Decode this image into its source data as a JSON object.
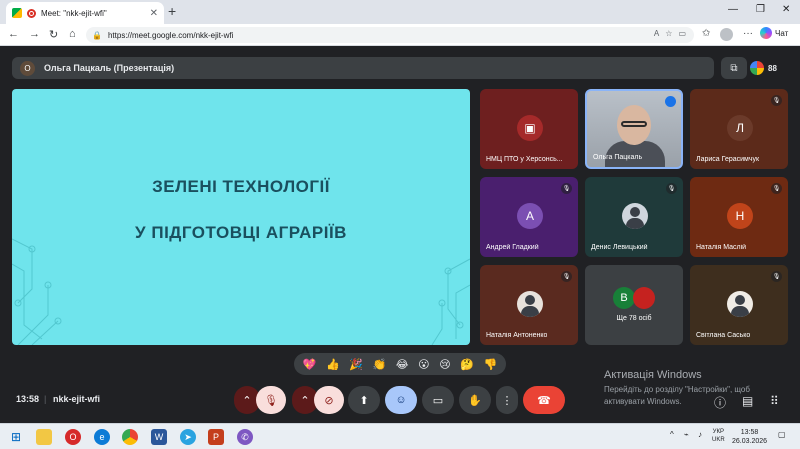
{
  "browser": {
    "tab_title": "Meet: \"nkk-ejit-wfi\"",
    "url": "https://meet.google.com/nkk-ejit-wfi",
    "chat_label": "Чат"
  },
  "meet": {
    "presenter_initial": "О",
    "presenter_label": "Ольга Пацкаль (Презентація)",
    "participants_count": "88",
    "slide": {
      "line1": "ЗЕЛЕНІ ТЕХНОЛОГІЇ",
      "line2": "У ПІДГОТОВЦІ АГРАРІЇВ"
    },
    "tiles": [
      {
        "name": "НМЦ ПТО у Херсонсь..."
      },
      {
        "name": "Ольга Пацкаль"
      },
      {
        "name": "Лариса Герасимчук",
        "initial": "Л"
      },
      {
        "name": "Андрей Гладкий",
        "initial": "А"
      },
      {
        "name": "Денис Левицький"
      },
      {
        "name": "Наталія Маслій",
        "initial": "Н"
      },
      {
        "name": "Наталія Антоненко"
      },
      {
        "name": "Ще 78 осіб",
        "initial": "В"
      },
      {
        "name": "Світлана Сасько"
      }
    ],
    "reactions": [
      "💖",
      "👍",
      "🎉",
      "👏",
      "😂",
      "😮",
      "😢",
      "🤔",
      "👎"
    ],
    "time": "13:58",
    "meeting_code": "nkk-ejit-wfi"
  },
  "watermark": {
    "title": "Активація Windows",
    "line1": "Перейдіть до розділу \"Настройки\", щоб",
    "line2": "активувати Windows."
  },
  "taskbar": {
    "lang1": "УКР",
    "lang2": "UKR",
    "time": "13:58",
    "date": "26.03.2026"
  },
  "colors": {
    "slide_bg": "#6fe4ec",
    "slide_text": "#1a4f5e",
    "hangup": "#ea4335",
    "active_blue": "#a8c7fa"
  }
}
